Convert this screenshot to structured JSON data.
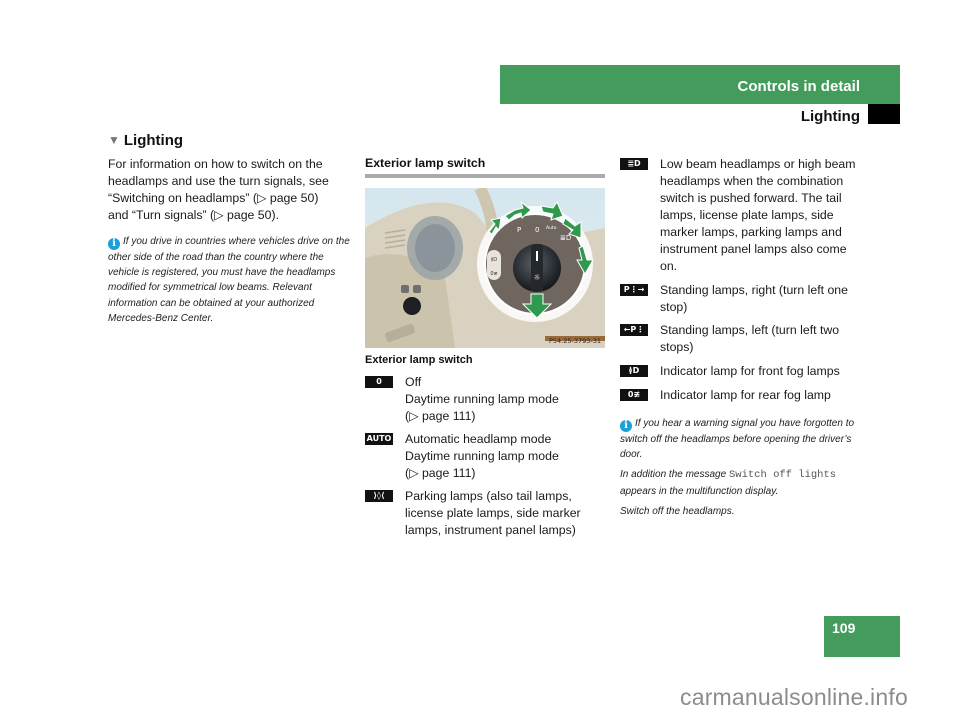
{
  "header": {
    "chapter": "Controls in detail",
    "section": "Lighting"
  },
  "section_heading": "Lighting",
  "intro": {
    "line1": "For information on how to switch on the",
    "line2": "headlamps and use the turn signals, see",
    "line3": "“Switching on headlamps” (▷ page 50)",
    "line4": "and “Turn signals” (▷ page 50)."
  },
  "note1": {
    "icon": "info-icon",
    "text": "If you drive in countries where vehicles drive on the other side of the road than the country where the vehicle is registered, you must have the headlamps modified for symmetrical low beams. Relevant information can be obtained at your authorized Mercedes-Benz Center."
  },
  "exterior": {
    "heading": "Exterior lamp switch",
    "illustration_code": "P54.25-3793-31",
    "dial_labels": [
      "P",
      "0",
      "Auto"
    ],
    "caption": "Exterior lamp switch",
    "items": [
      {
        "symbol": "0",
        "icon": "off-position-icon",
        "lines": [
          "Off",
          "Daytime running lamp mode",
          "(▷ page 111)"
        ]
      },
      {
        "symbol": "AUTO",
        "icon": "auto-headlamp-icon",
        "lines": [
          "Automatic headlamp mode",
          "Daytime running lamp mode",
          "(▷ page 111)"
        ]
      },
      {
        "symbol": "⟩◊⟨",
        "icon": "parking-lamps-icon",
        "lines": [
          "Parking lamps (also tail lamps,",
          "license plate lamps, side marker",
          "lamps, instrument panel lamps)"
        ]
      }
    ]
  },
  "col3_items": [
    {
      "symbol": "≣D",
      "icon": "low-beam-icon",
      "lines": [
        "Low beam headlamps or high beam",
        "headlamps when the combination",
        "switch is pushed forward. The tail",
        "lamps, license plate lamps, side",
        "marker lamps, parking lamps and",
        "instrument panel lamps also come",
        "on."
      ]
    },
    {
      "symbol": "P⋮→",
      "icon": "standing-lamps-right-icon",
      "lines": [
        "Standing lamps, right (turn left one",
        "stop)"
      ]
    },
    {
      "symbol": "←P⋮",
      "icon": "standing-lamps-left-icon",
      "lines": [
        "Standing lamps, left (turn left two",
        "stops)"
      ]
    },
    {
      "symbol": "≬D",
      "icon": "front-fog-lamp-icon",
      "lines": [
        "Indicator lamp for front fog lamps"
      ]
    },
    {
      "symbol": "0≢",
      "icon": "rear-fog-lamp-icon",
      "lines": [
        "Indicator lamp for rear fog lamp"
      ]
    }
  ],
  "note2": {
    "icon": "info-icon",
    "text1": "If you hear a warning signal you have forgotten to switch off the headlamps before opening the driver’s door.",
    "text2_before": "In addition the message ",
    "text2_mono": "Switch off lights",
    "text2_after": " appears in the multifunction display.",
    "text3": "Switch off the headlamps."
  },
  "page_number": "109",
  "watermark": "carmanualsonline.info",
  "colors": {
    "brand_green": "#439c5c",
    "info_blue": "#1aa1dc",
    "arrow_green": "#2f9a4e"
  }
}
